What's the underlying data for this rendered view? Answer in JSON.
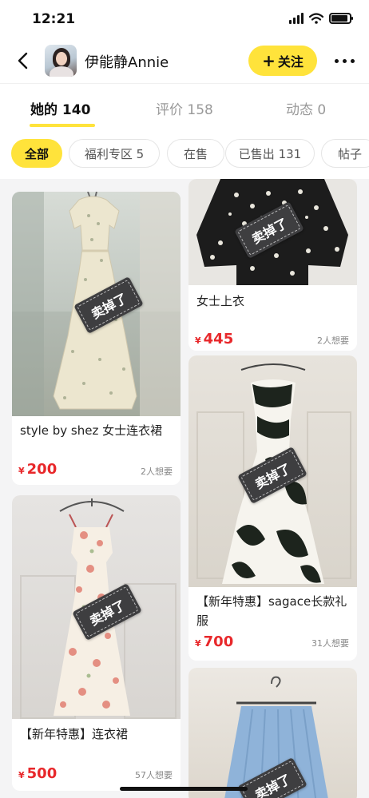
{
  "status_bar": {
    "time": "12:21"
  },
  "header": {
    "username": "伊能静Annie",
    "follow_label": "关注"
  },
  "tabs": [
    {
      "label": "她的 140"
    },
    {
      "label": "评价 158"
    },
    {
      "label": "动态 0"
    }
  ],
  "filters": [
    {
      "label": "全部"
    },
    {
      "label": "福利专区 5"
    },
    {
      "label": "在售"
    },
    {
      "label": "已售出 131"
    },
    {
      "label": "帖子"
    }
  ],
  "sold_stamp_label": "卖掉了",
  "items": [
    {
      "title": "style by shez 女士连衣裙",
      "currency": "¥",
      "price": "200",
      "wants": "2人想要",
      "sold": true
    },
    {
      "title": "【新年特惠】连衣裙",
      "currency": "¥",
      "price": "500",
      "wants": "57人想要",
      "sold": true
    },
    {
      "title": "女士上衣",
      "currency": "¥",
      "price": "445",
      "wants": "2人想要",
      "sold": true
    },
    {
      "title": "【新年特惠】sagace长款礼服",
      "currency": "¥",
      "price": "700",
      "wants": "31人想要",
      "sold": true
    },
    {
      "title": "",
      "currency": "",
      "price": "",
      "wants": "",
      "sold": true
    }
  ],
  "colors": {
    "accent": "#ffe33b",
    "price": "#e8282b",
    "stamp": "#3e3e40"
  }
}
